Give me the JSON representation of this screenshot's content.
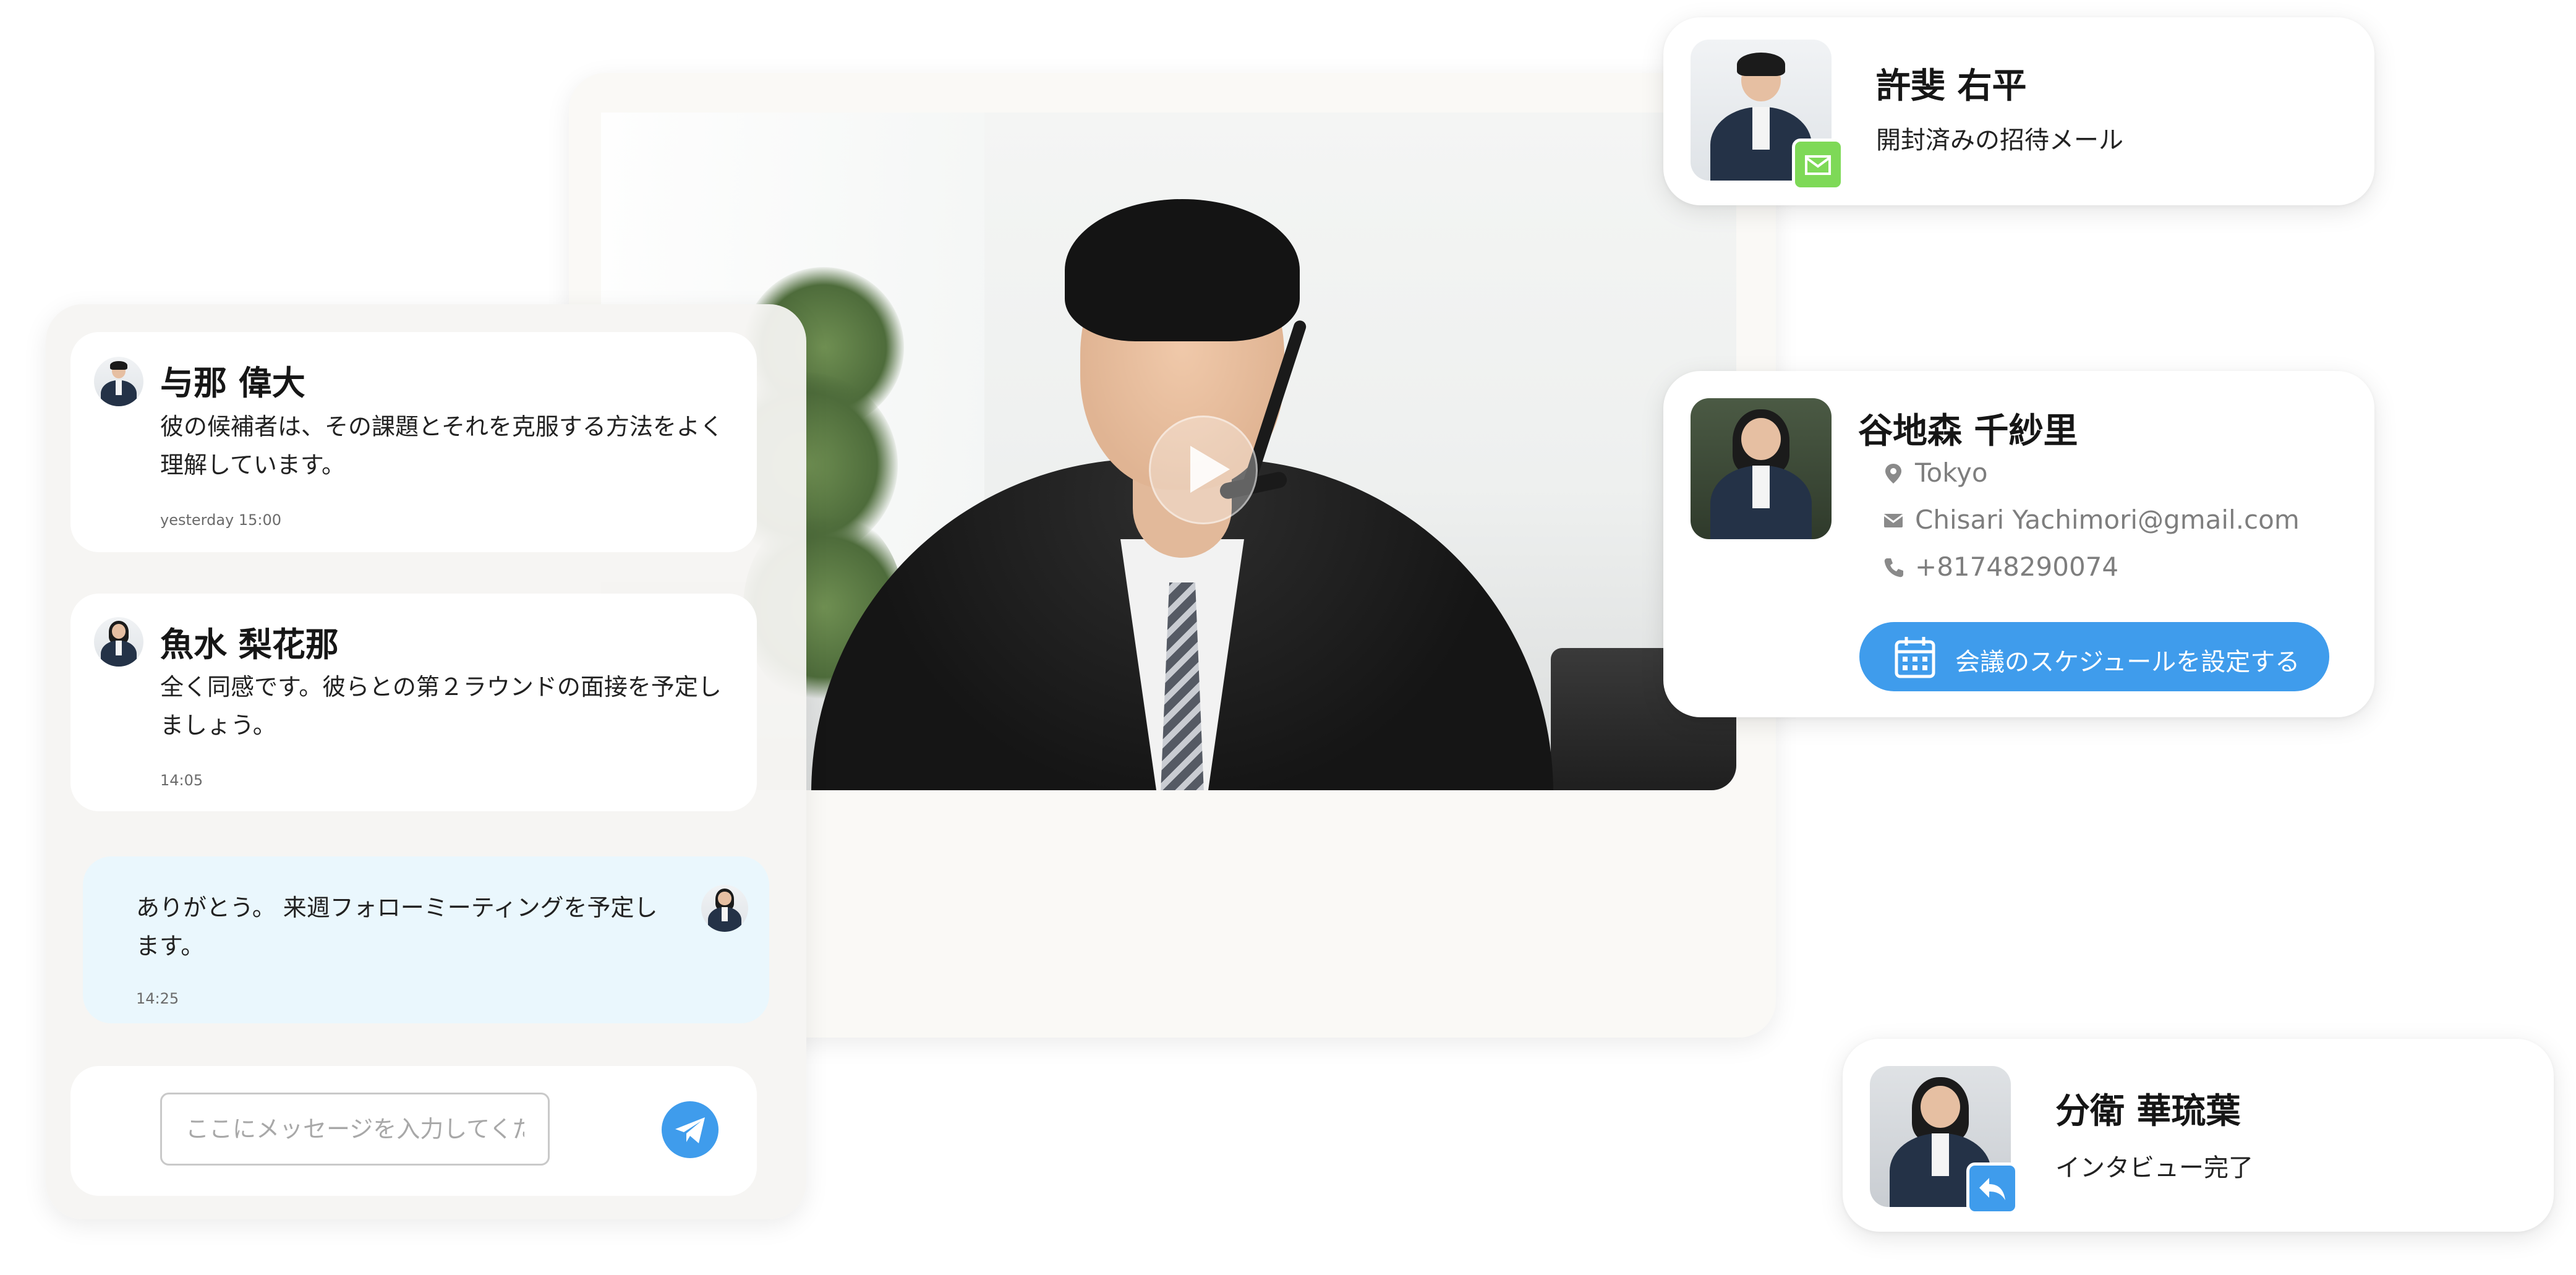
{
  "chat": {
    "messages": [
      {
        "name": "与那 偉大",
        "text": "彼の候補者は、その課題とそれを克服する方法をよく理解しています。",
        "time": "yesterday 15:00"
      },
      {
        "name": "魚水 梨花那",
        "text": "全く同感です。彼らとの第２ラウンドの面接を予定しましょう。",
        "time": "14:05"
      },
      {
        "text": "ありがとう。 来週フォローミーティングを予定します。",
        "time": "14:25"
      }
    ],
    "input_placeholder": "ここにメッセージを入力してください",
    "send_icon": "paper-plane-icon"
  },
  "video": {
    "play_icon": "play-icon"
  },
  "candidates": [
    {
      "name": "許斐 右平",
      "status": "開封済みの招待メール",
      "badge_icon": "email-opened-icon",
      "badge_color": "#7ed957"
    },
    {
      "name": "谷地森 千紗里",
      "location": "Tokyo",
      "email": "Chisari Yachimori@gmail.com",
      "phone": "+81748290074",
      "action_label": "会議のスケジュールを設定する",
      "action_icon": "calendar-icon",
      "action_color": "#3f9cec"
    },
    {
      "name": "分衛 華琉葉",
      "status": "インタビュー完了",
      "badge_icon": "reply-icon",
      "badge_color": "#3f9cec"
    }
  ]
}
